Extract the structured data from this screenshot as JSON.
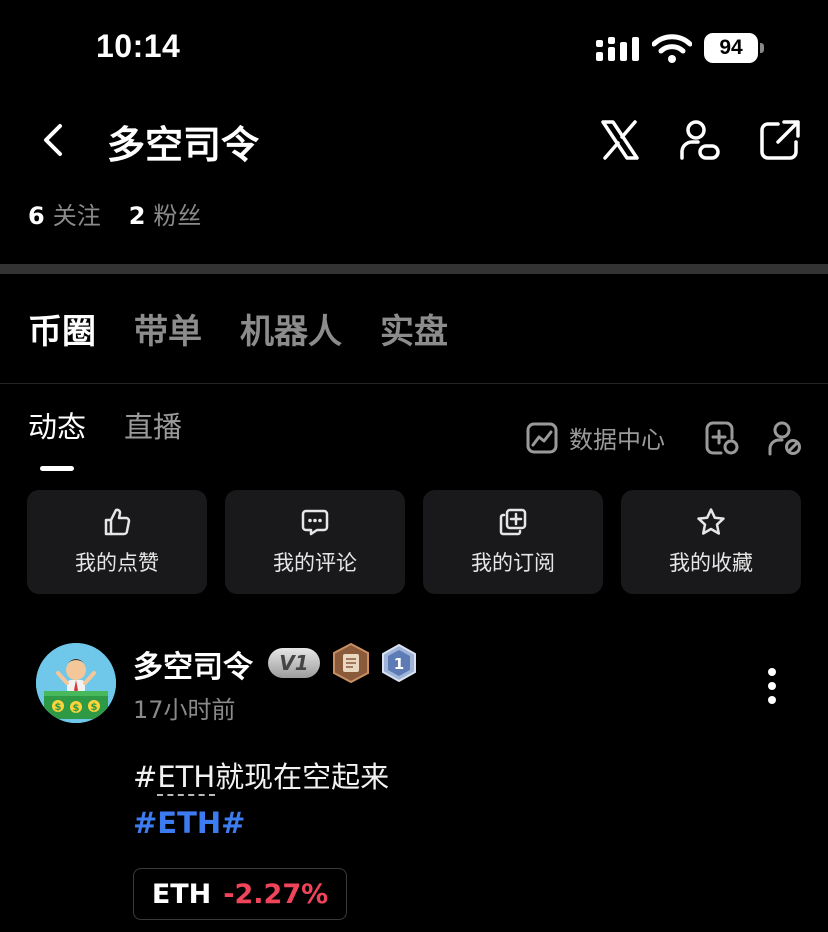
{
  "status_bar": {
    "time": "10:14",
    "battery": "94"
  },
  "header": {
    "title": "多空司令"
  },
  "stats": {
    "following_count": "6",
    "following_label": "关注",
    "followers_count": "2",
    "followers_label": "粉丝"
  },
  "main_tabs": [
    {
      "label": "币圈",
      "active": true
    },
    {
      "label": "带单",
      "active": false
    },
    {
      "label": "机器人",
      "active": false
    },
    {
      "label": "实盘",
      "active": false
    }
  ],
  "sub_tabs": [
    {
      "label": "动态",
      "active": true
    },
    {
      "label": "直播",
      "active": false
    }
  ],
  "data_center_label": "数据中心",
  "quick_actions": [
    {
      "icon": "thumbs-up-icon",
      "label": "我的点赞"
    },
    {
      "icon": "comment-icon",
      "label": "我的评论"
    },
    {
      "icon": "subscribe-icon",
      "label": "我的订阅"
    },
    {
      "icon": "star-icon",
      "label": "我的收藏"
    }
  ],
  "post": {
    "author": "多空司令",
    "vip_badge": "V1",
    "level_badge": "1",
    "time": "17小时前",
    "text_prefix": "#",
    "text_linked": "ETH",
    "text_suffix": "就现在空起来",
    "hashtag": "#ETH#",
    "ticker": {
      "symbol": "ETH",
      "change": "-2.27%"
    }
  },
  "colors": {
    "background": "#000000",
    "hashtag": "#3d7cf0",
    "negative": "#f0445a",
    "card": "#19191b"
  }
}
